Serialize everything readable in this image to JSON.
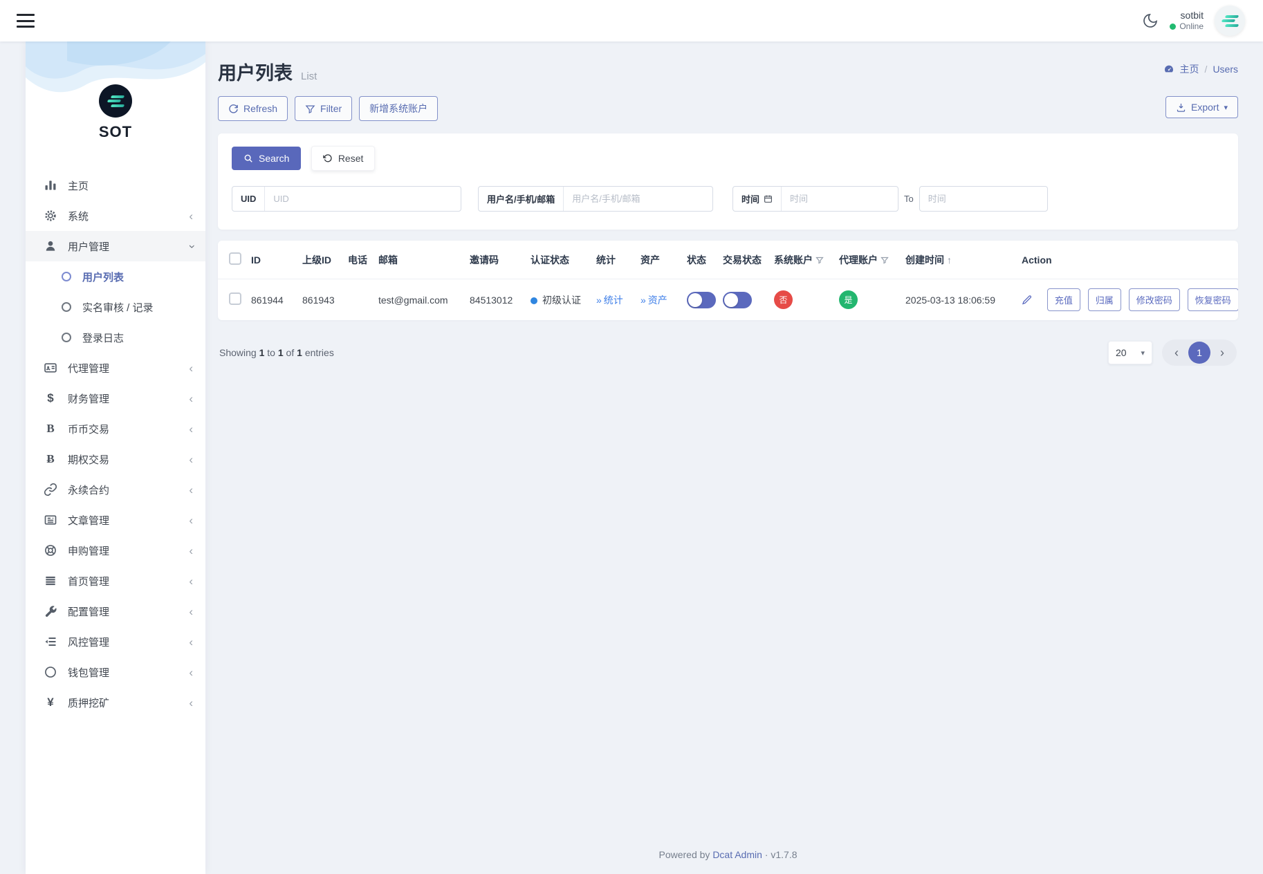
{
  "topbar": {
    "user_name": "sotbit",
    "status": "Online"
  },
  "sidebar": {
    "logo_text": "SOT",
    "items": [
      {
        "label": "主页"
      },
      {
        "label": "系统"
      },
      {
        "label": "用户管理",
        "children": [
          {
            "label": "用户列表"
          },
          {
            "label": "实名审核 / 记录"
          },
          {
            "label": "登录日志"
          }
        ]
      },
      {
        "label": "代理管理"
      },
      {
        "label": "财务管理"
      },
      {
        "label": "币币交易"
      },
      {
        "label": "期权交易"
      },
      {
        "label": "永续合约"
      },
      {
        "label": "文章管理"
      },
      {
        "label": "申购管理"
      },
      {
        "label": "首页管理"
      },
      {
        "label": "配置管理"
      },
      {
        "label": "风控管理"
      },
      {
        "label": "钱包管理"
      },
      {
        "label": "质押挖矿"
      }
    ]
  },
  "page": {
    "title": "用户列表",
    "subtitle": "List"
  },
  "breadcrumb": {
    "home": "主页",
    "separator": "/",
    "current": "Users"
  },
  "toolbar": {
    "refresh": "Refresh",
    "filter": "Filter",
    "add_account": "新增系统账户",
    "export": "Export"
  },
  "filterbar": {
    "search": "Search",
    "reset": "Reset",
    "uid": {
      "label": "UID",
      "placeholder": "UID"
    },
    "account": {
      "label": "用户名/手机/邮箱",
      "placeholder": "用户名/手机/邮箱"
    },
    "time_start": {
      "label": "时间",
      "placeholder": "时间"
    },
    "to_label": "To",
    "time_end": {
      "placeholder": "时间"
    }
  },
  "table": {
    "columns": {
      "id": "ID",
      "parent_id": "上级ID",
      "phone": "电话",
      "email": "邮箱",
      "invite_code": "邀请码",
      "auth_status": "认证状态",
      "stats": "统计",
      "assets": "资产",
      "status": "状态",
      "trade_status": "交易状态",
      "system_account": "系统账户",
      "agent_account": "代理账户",
      "created_at": "创建时间",
      "action": "Action"
    },
    "row": {
      "id": "861944",
      "parent_id": "861943",
      "phone": "",
      "email": "test@gmail.com",
      "invite_code": "84513012",
      "auth_status": "初级认证",
      "stats_link": "统计",
      "assets_link": "资产",
      "system_account": "否",
      "agent_account": "是",
      "created_at": "2025-03-13 18:06:59",
      "actions": {
        "recharge": "充值",
        "belong": "归属",
        "change_password": "修改密码",
        "restore_password": "恢复密码"
      }
    }
  },
  "pagination": {
    "showing": {
      "prefix": "Showing",
      "n1": "1",
      "to": "to",
      "n2": "1",
      "of": "of",
      "n3": "1",
      "suffix": "entries"
    },
    "per_page": "20",
    "page": "1",
    "prev": "‹",
    "next": "›"
  },
  "footer": {
    "powered_by": "Powered by",
    "brand": "Dcat Admin",
    "separator": "·",
    "version": "v1.7.8"
  },
  "colors": {
    "primary": "#586cb1",
    "danger": "#e64b47",
    "success": "#23b66f",
    "link_blue": "#3d7ee8",
    "brand_teal": "#2fbfa4"
  }
}
